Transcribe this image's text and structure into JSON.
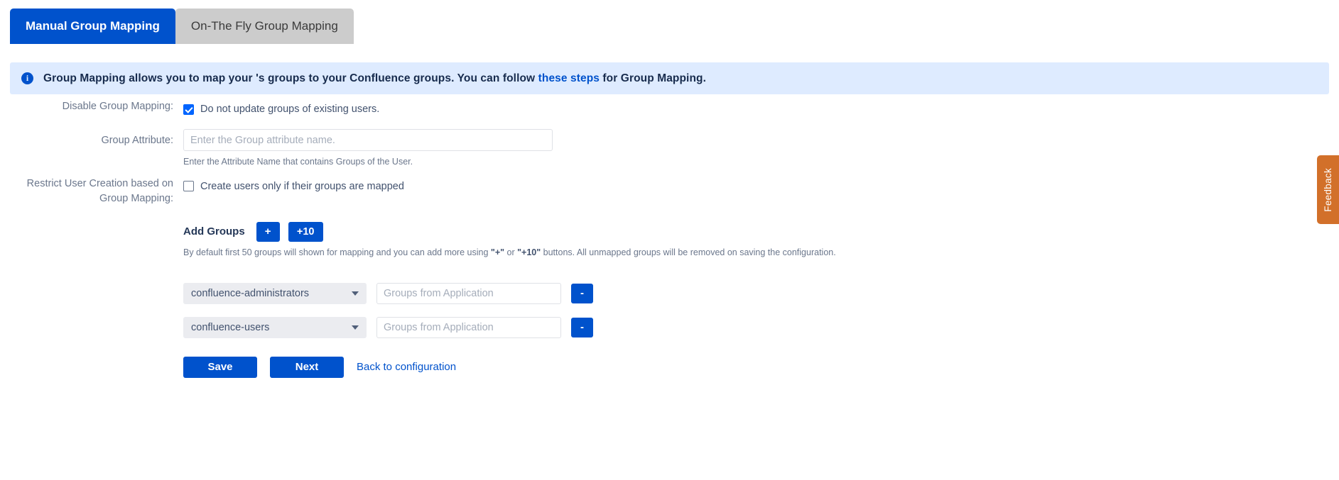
{
  "tabs": [
    {
      "label": "Manual Group Mapping",
      "active": true
    },
    {
      "label": "On-The Fly Group Mapping",
      "active": false
    }
  ],
  "banner": {
    "icon": "info-icon",
    "text_before_link": "Group Mapping allows you to map your 's groups to your Confluence groups. You can follow ",
    "link_text": "these steps",
    "text_after_link": " for Group Mapping."
  },
  "form": {
    "disable_group_mapping": {
      "label": "Disable Group Mapping:",
      "checkbox_label": "Do not update groups of existing users.",
      "checked": true
    },
    "group_attribute": {
      "label": "Group Attribute:",
      "placeholder": "Enter the Group attribute name.",
      "value": "",
      "helper": "Enter the Attribute Name that contains Groups of the User."
    },
    "restrict_user_creation": {
      "label": "Restrict User Creation based on Group Mapping:",
      "checkbox_label": "Create users only if their groups are mapped",
      "checked": false
    },
    "add_groups": {
      "label": "Add Groups",
      "plus_button": "+",
      "plus_ten_button": "+10",
      "helper_part1": "By default first 50 groups will shown for mapping and you can add more using ",
      "helper_quote1": "\"+\"",
      "helper_part2": " or ",
      "helper_quote2": "\"+10\"",
      "helper_part3": " buttons. All unmapped groups will be removed on saving the configuration."
    },
    "mapping_rows": [
      {
        "group": "confluence-administrators",
        "app_groups_placeholder": "Groups from Application",
        "app_groups_value": "",
        "remove_button": "-"
      },
      {
        "group": "confluence-users",
        "app_groups_placeholder": "Groups from Application",
        "app_groups_value": "",
        "remove_button": "-"
      }
    ]
  },
  "footer": {
    "save_label": "Save",
    "next_label": "Next",
    "back_link": "Back to configuration"
  },
  "feedback": {
    "label": "Feedback"
  },
  "colors": {
    "primary": "#0052cc",
    "banner_bg": "#deebff",
    "tab_inactive_bg": "#cccccc",
    "select_bg": "#ebecf0",
    "feedback_bg": "#d2702a",
    "muted_text": "#6b778c"
  }
}
